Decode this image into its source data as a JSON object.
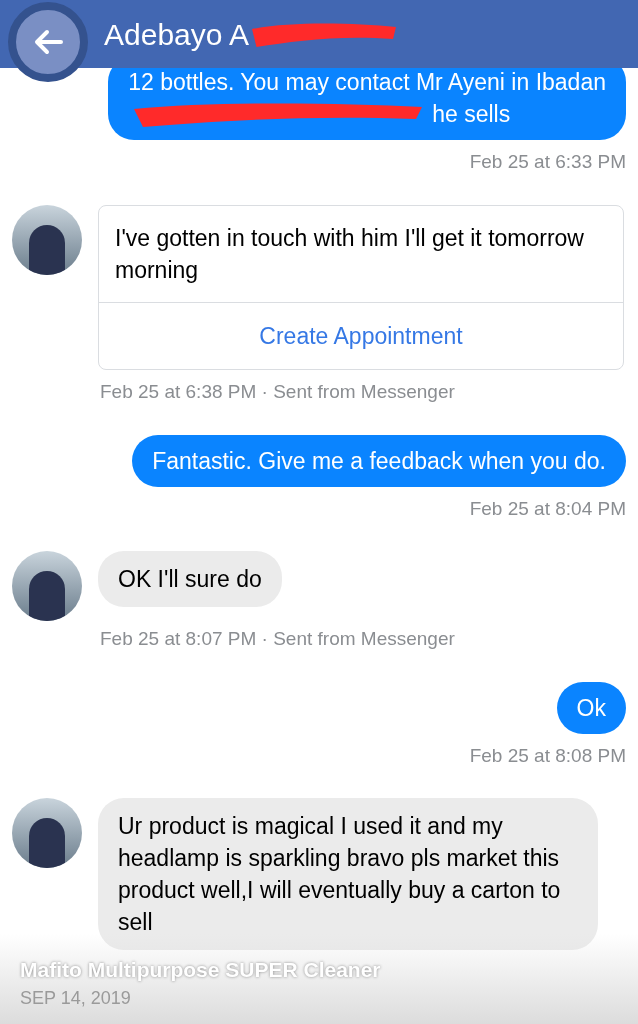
{
  "header": {
    "title": "Adebayo A",
    "title_redacted": true
  },
  "messages": [
    {
      "kind": "sent",
      "lines": [
        "12 bottles. You may contact Mr Ayeni in Ibadan",
        "he sells"
      ],
      "line_redacted": [
        false,
        true
      ],
      "time": "Feb 25 at 6:33 PM"
    },
    {
      "kind": "card",
      "text": "I've gotten in touch with him I'll get it tomorrow morning",
      "action": "Create Appointment",
      "time": "Feb 25 at 6:38 PM · Sent from Messenger"
    },
    {
      "kind": "sent",
      "lines": [
        "Fantastic. Give me a feedback when you do."
      ],
      "time": "Feb 25 at 8:04 PM"
    },
    {
      "kind": "received",
      "lines": [
        "OK I'll sure do"
      ],
      "time": "Feb 25 at 8:07 PM · Sent from Messenger"
    },
    {
      "kind": "sent",
      "lines": [
        "Ok"
      ],
      "time": "Feb 25 at 8:08 PM"
    },
    {
      "kind": "received",
      "lines": [
        "Ur product is magical I used it and my headlamp is sparkling bravo pls market this product well,I will eventually buy a carton to sell"
      ]
    }
  ],
  "overlay": {
    "caption": "Mafito Multipurpose SUPER Cleaner",
    "date": "SEP 14, 2019"
  }
}
